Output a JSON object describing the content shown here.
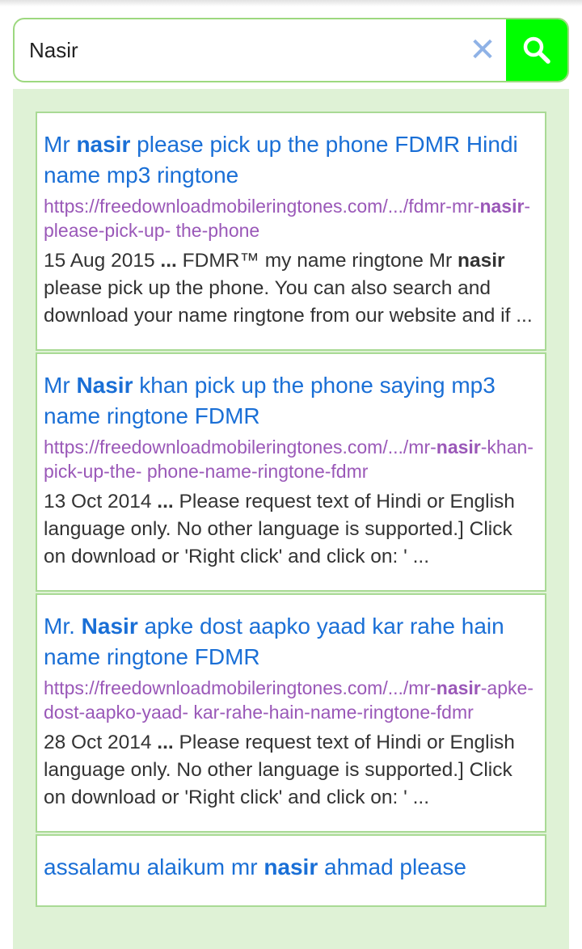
{
  "search": {
    "query": "Nasir",
    "clear_glyph": "✕",
    "search_icon": "magnifier-icon"
  },
  "colors": {
    "search_button": "#00ff00",
    "title_link": "#1a6fd6",
    "url": "#9a58b8",
    "panel_bg": "#dff2d6",
    "border": "#a9da95"
  },
  "results": [
    {
      "title": {
        "pre": "Mr ",
        "bold": "nasir",
        "post": " please pick up the phone FDMR Hindi name mp3 ringtone"
      },
      "url": {
        "pre": "https://freedownloadmobileringtones.com/.../fdmr-mr-",
        "bold": "nasir",
        "post": "-please-pick-up- the-phone"
      },
      "snippet": {
        "date": "15 Aug 2015",
        "ellipsis": " ... ",
        "pre": "FDMR™ my name ringtone Mr ",
        "bold": "nasir",
        "post": " please pick up the phone. You can also search and download your name ringtone from our website and if ..."
      }
    },
    {
      "title": {
        "pre": "Mr ",
        "bold": "Nasir",
        "post": " khan pick up the phone saying mp3 name ringtone FDMR"
      },
      "url": {
        "pre": "https://freedownloadmobileringtones.com/.../mr-",
        "bold": "nasir",
        "post": "-khan-pick-up-the- phone-name-ringtone-fdmr"
      },
      "snippet": {
        "date": "13 Oct 2014",
        "ellipsis": " ... ",
        "pre": "Please request text of Hindi or English language only. No other language is supported.] Click on download or 'Right click' and click on: ' ...",
        "bold": "",
        "post": ""
      }
    },
    {
      "title": {
        "pre": "Mr. ",
        "bold": "Nasir",
        "post": " apke dost aapko yaad kar rahe hain name ringtone FDMR"
      },
      "url": {
        "pre": "https://freedownloadmobileringtones.com/.../mr-",
        "bold": "nasir",
        "post": "-apke-dost-aapko-yaad- kar-rahe-hain-name-ringtone-fdmr"
      },
      "snippet": {
        "date": "28 Oct 2014",
        "ellipsis": " ... ",
        "pre": "Please request text of Hindi or English language only. No other language is supported.] Click on download or 'Right click' and click on: ' ...",
        "bold": "",
        "post": ""
      }
    },
    {
      "title": {
        "pre": "assalamu alaikum mr ",
        "bold": "nasir",
        "post": " ahmad please"
      },
      "url": {
        "pre": "",
        "bold": "",
        "post": ""
      },
      "snippet": {
        "date": "",
        "ellipsis": "",
        "pre": "",
        "bold": "",
        "post": ""
      }
    }
  ]
}
